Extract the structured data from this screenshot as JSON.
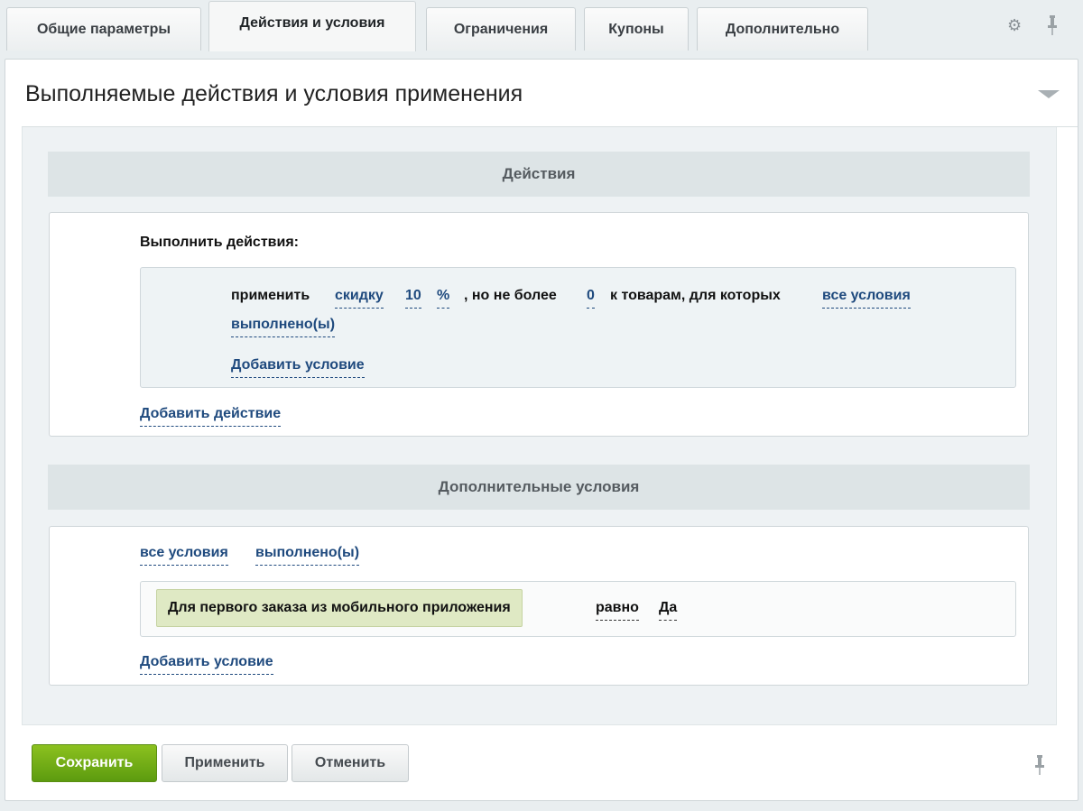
{
  "tabs": [
    {
      "label": "Общие параметры",
      "active": false
    },
    {
      "label": "Действия и условия",
      "active": true
    },
    {
      "label": "Ограничения",
      "active": false
    },
    {
      "label": "Купоны",
      "active": false
    },
    {
      "label": "Дополнительно",
      "active": false
    }
  ],
  "panel": {
    "title": "Выполняемые действия и условия применения"
  },
  "actions": {
    "header": "Действия",
    "label": "Выполнить действия:",
    "rule": {
      "apply": "применить",
      "discount": "скидку",
      "amount": "10",
      "unit": "%",
      "max_text": ", но не более",
      "max_value": "0",
      "for_text": "к товарам, для которых",
      "all_conditions": "все условия",
      "fulfilled": "выполнено(ы)",
      "add_condition": "Добавить условие"
    },
    "add_action": "Добавить действие"
  },
  "extra": {
    "header": "Дополнительные условия",
    "all_conditions": "все условия",
    "fulfilled": "выполнено(ы)",
    "condition": {
      "name": "Для первого заказа из мобильного приложения",
      "operator": "равно",
      "value": "Да"
    },
    "add_condition": "Добавить условие"
  },
  "buttons": {
    "save": "Сохранить",
    "apply": "Применить",
    "cancel": "Отменить"
  },
  "colors": {
    "save_button": "#6aaa14",
    "link": "#1f4a7e",
    "condition_chip": "#dfe9c4"
  }
}
